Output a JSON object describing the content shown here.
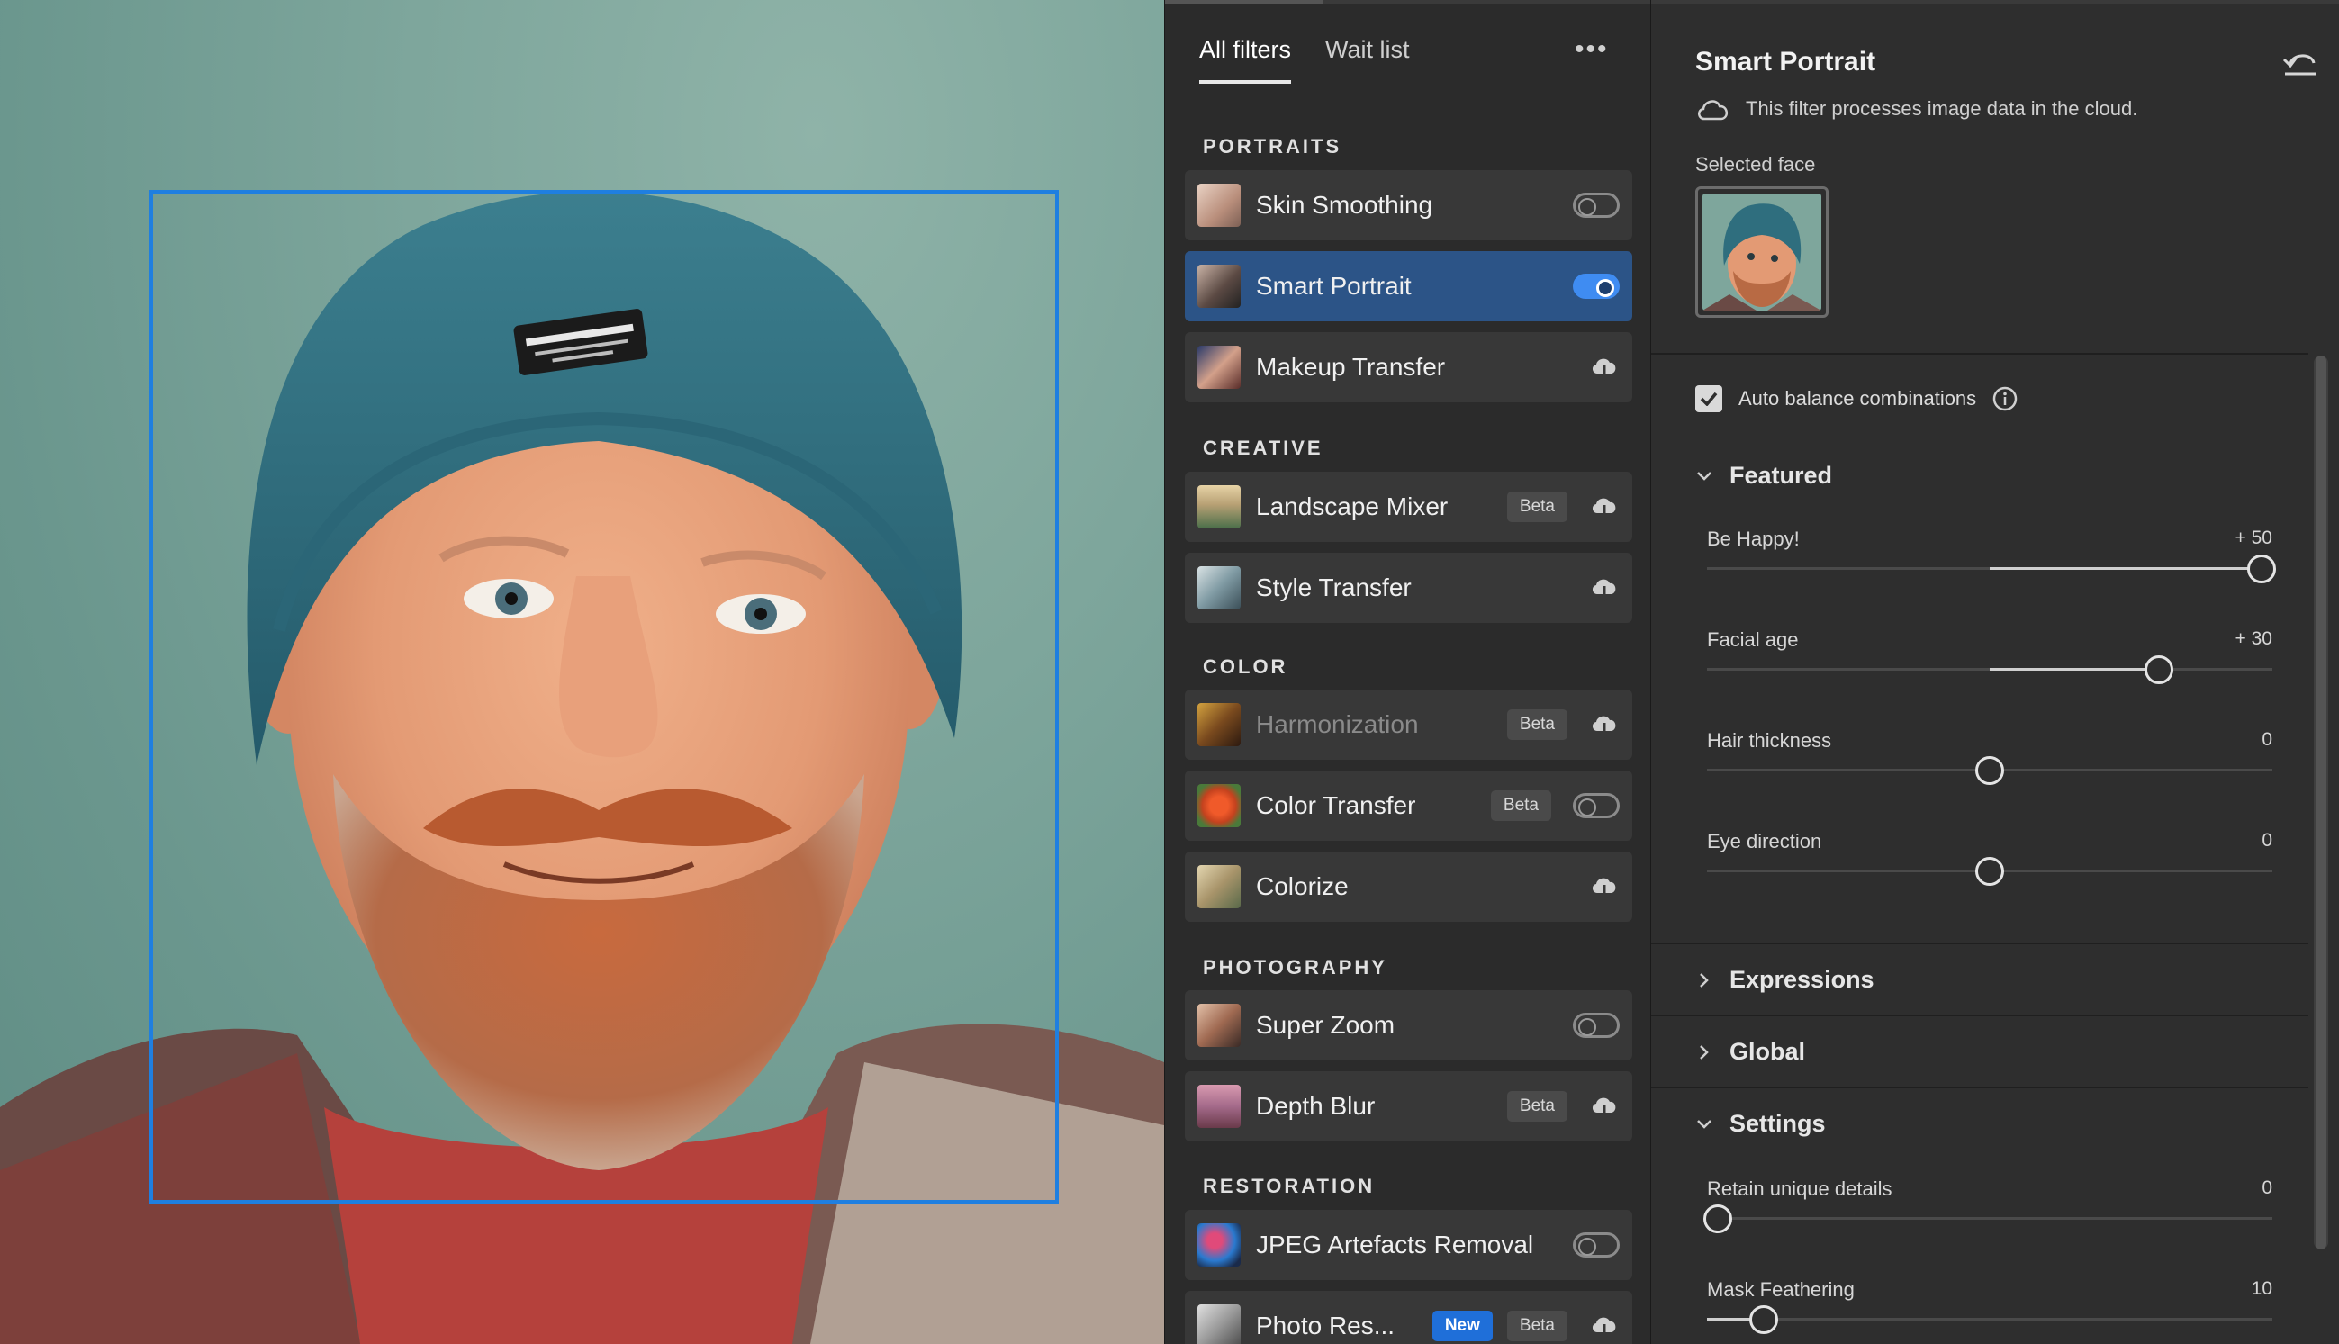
{
  "filters_panel": {
    "tabs": [
      {
        "label": "All filters",
        "active": true
      },
      {
        "label": "Wait list",
        "active": false
      }
    ],
    "more_icon": "ellipsis-icon",
    "sections": [
      {
        "title": "PORTRAITS",
        "items": [
          {
            "label": "Skin Smoothing",
            "control": "toggle",
            "on": false
          },
          {
            "label": "Smart Portrait",
            "control": "toggle",
            "on": true,
            "selected": true
          },
          {
            "label": "Makeup Transfer",
            "control": "cloud-download"
          }
        ]
      },
      {
        "title": "CREATIVE",
        "items": [
          {
            "label": "Landscape Mixer",
            "badges": [
              "Beta"
            ],
            "control": "cloud-download"
          },
          {
            "label": "Style Transfer",
            "control": "cloud-download"
          }
        ]
      },
      {
        "title": "COLOR",
        "items": [
          {
            "label": "Harmonization",
            "badges": [
              "Beta"
            ],
            "control": "cloud-download",
            "dimmed": true
          },
          {
            "label": "Color Transfer",
            "badges": [
              "Beta"
            ],
            "control": "toggle",
            "on": false
          },
          {
            "label": "Colorize",
            "control": "cloud-download"
          }
        ]
      },
      {
        "title": "PHOTOGRAPHY",
        "items": [
          {
            "label": "Super Zoom",
            "control": "toggle",
            "on": false
          },
          {
            "label": "Depth Blur",
            "badges": [
              "Beta"
            ],
            "control": "cloud-download"
          }
        ]
      },
      {
        "title": "RESTORATION",
        "items": [
          {
            "label": "JPEG Artefacts Removal",
            "control": "toggle",
            "on": false
          },
          {
            "label": "Photo Res...",
            "badges": [
              "New",
              "Beta"
            ],
            "control": "cloud-download"
          }
        ]
      }
    ]
  },
  "props_panel": {
    "title": "Smart Portrait",
    "reset_icon": "reset-icon",
    "cloud_note": "This filter processes image data in the cloud.",
    "selected_face_label": "Selected face",
    "auto_balance": {
      "label": "Auto balance combinations",
      "checked": true
    },
    "groups": {
      "featured": {
        "label": "Featured",
        "expanded": true,
        "sliders": [
          {
            "label": "Be Happy!",
            "value": "+ 50",
            "num": 50,
            "min": -50,
            "max": 50
          },
          {
            "label": "Facial age",
            "value": "+ 30",
            "num": 30,
            "min": -50,
            "max": 50
          },
          {
            "label": "Hair thickness",
            "value": "0",
            "num": 0,
            "min": -50,
            "max": 50
          },
          {
            "label": "Eye direction",
            "value": "0",
            "num": 0,
            "min": -50,
            "max": 50
          }
        ]
      },
      "expressions": {
        "label": "Expressions",
        "expanded": false
      },
      "global": {
        "label": "Global",
        "expanded": false
      },
      "settings": {
        "label": "Settings",
        "expanded": true,
        "sliders": [
          {
            "label": "Retain unique details",
            "value": "0",
            "num": 0,
            "min": 0,
            "max": 100
          },
          {
            "label": "Mask Feathering",
            "value": "10",
            "num": 10,
            "min": 0,
            "max": 100
          }
        ]
      }
    }
  },
  "colors": {
    "accent": "#3f8cf2",
    "selected_item": "#2c5487",
    "new_badge": "#1f6fd9",
    "face_frame": "#1f7fe0"
  }
}
